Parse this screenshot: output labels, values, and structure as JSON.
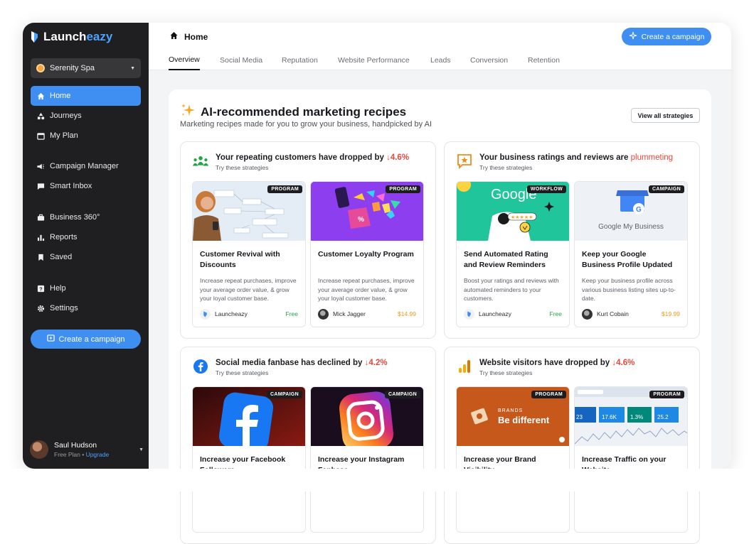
{
  "app": {
    "name_part1": "Launch",
    "name_part2": "eazy"
  },
  "sidebar": {
    "brand_selector": "Serenity Spa",
    "items": [
      {
        "label": "Home",
        "icon": "home-icon"
      },
      {
        "label": "Journeys",
        "icon": "journeys-icon"
      },
      {
        "label": "My Plan",
        "icon": "calendar-icon"
      },
      {
        "label": "Campaign Manager",
        "icon": "megaphone-icon"
      },
      {
        "label": "Smart Inbox",
        "icon": "inbox-icon"
      },
      {
        "label": "Business 360°",
        "icon": "briefcase-icon"
      },
      {
        "label": "Reports",
        "icon": "bar-chart-icon"
      },
      {
        "label": "Saved",
        "icon": "bookmark-icon"
      },
      {
        "label": "Help",
        "icon": "help-icon"
      },
      {
        "label": "Settings",
        "icon": "gear-icon"
      }
    ],
    "create_label": "Create a campaign",
    "user": {
      "name": "Saul Hudson",
      "plan": "Free Plan",
      "separator": " • ",
      "upgrade": "Upgrade"
    }
  },
  "header": {
    "title": "Home",
    "create_label": "Create a campaign"
  },
  "tabs": [
    "Overview",
    "Social Media",
    "Reputation",
    "Website Performance",
    "Leads",
    "Conversion",
    "Retention"
  ],
  "recipes": {
    "title": "AI-recommended marketing recipes",
    "subtitle": "Marketing recipes made for you to grow your business, handpicked by AI",
    "view_all": "View all strategies",
    "groups": [
      {
        "title": "Your repeating customers have dropped by",
        "metric": "↓4.6%",
        "sub": "Try these strategies",
        "cards": [
          {
            "tag": "PROGRAM",
            "title": "Customer Revival with Discounts",
            "desc": "Increase repeat purchases, improve your average order value, & grow your loyal customer base.",
            "author": "Launcheazy",
            "price": "Free"
          },
          {
            "tag": "PROGRAM",
            "title": "Customer Loyalty Program",
            "desc": "Increase repeat purchases, improve your average order value, & grow your loyal customer base.",
            "author": "Mick Jagger",
            "price": "$14.99"
          }
        ]
      },
      {
        "title": "Your business ratings and reviews are",
        "metric": "plummeting",
        "sub": "Try these strategies",
        "cards": [
          {
            "tag": "WORKFLOW",
            "title": "Send Automated Rating and Review Reminders",
            "desc": "Boost your ratings and reviews with automated reminders to your customers.",
            "author": "Launcheazy",
            "price": "Free",
            "img_text": "Google"
          },
          {
            "tag": "CAMPAIGN",
            "title": "Keep your Google Business Profile Updated",
            "desc": "Keep your business profile across various business listing sites up-to-date.",
            "author": "Kurt Cobain",
            "price": "$19.99",
            "img_text": "Google My Business"
          }
        ]
      },
      {
        "title": "Social media fanbase has declined by",
        "metric": "↓4.2%",
        "sub": "Try these strategies",
        "cards": [
          {
            "tag": "CAMPAIGN",
            "title": "Increase your Facebook Followers"
          },
          {
            "tag": "CAMPAIGN",
            "title": "Increase your Instagram Fanbase"
          }
        ]
      },
      {
        "title": "Website visitors have dropped by",
        "metric": "↓4.6%",
        "sub": "Try these strategies",
        "cards": [
          {
            "tag": "PROGRAM",
            "title": "Increase your Brand Visibility",
            "img_small": "BRANDS",
            "img_big": "Be different"
          },
          {
            "tag": "PROGRAM",
            "title": "Increase Traffic on your Website",
            "stats": [
              "23",
              "17.6K",
              "1.3%",
              "25.2"
            ]
          }
        ]
      }
    ]
  },
  "colors": {
    "accent": "#3f8ef2",
    "sidebar_bg": "#1f1f21",
    "decline": "#e5483b",
    "free": "#22a447",
    "price": "#f39a16"
  }
}
